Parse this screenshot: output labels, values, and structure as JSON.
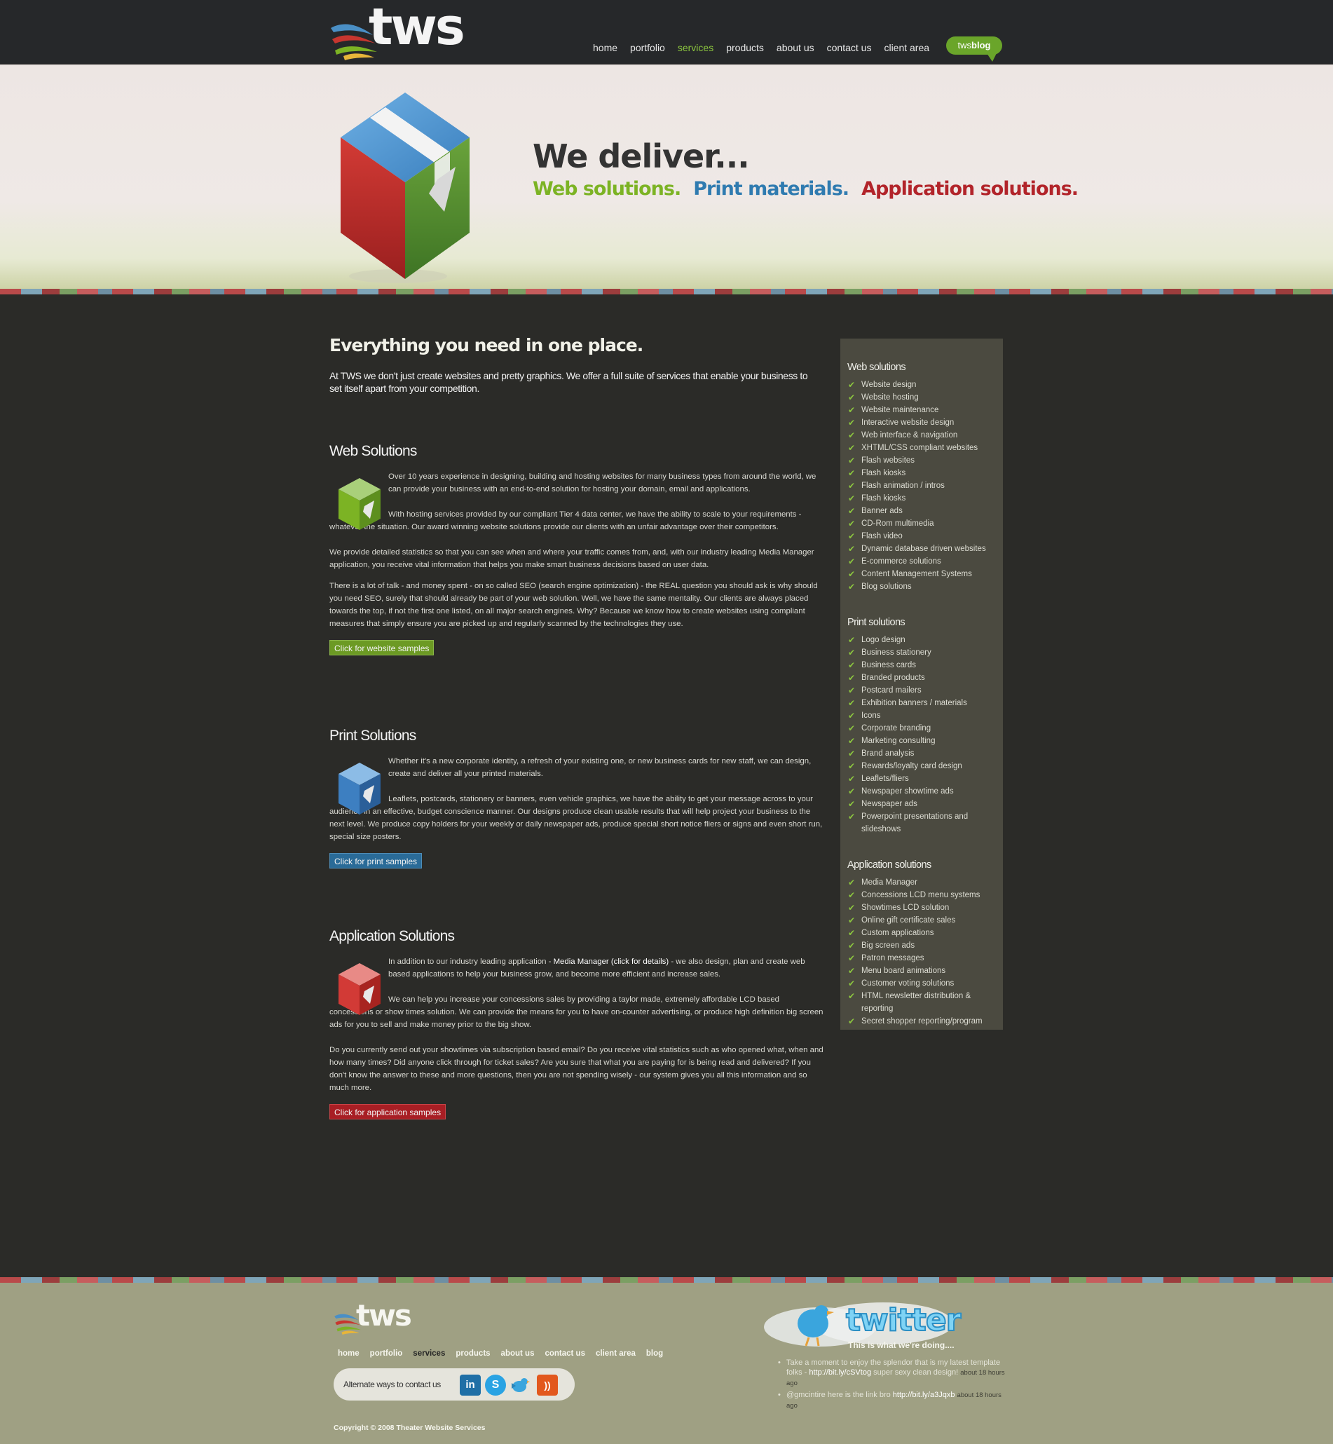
{
  "header": {
    "logo_text": "tws",
    "nav": [
      {
        "label": "home",
        "active": false
      },
      {
        "label": "portfolio",
        "active": false
      },
      {
        "label": "services",
        "active": true
      },
      {
        "label": "products",
        "active": false
      },
      {
        "label": "about us",
        "active": false
      },
      {
        "label": "contact us",
        "active": false
      },
      {
        "label": "client area",
        "active": false
      }
    ],
    "blog_badge": {
      "part1": "tws",
      "part2": "blog"
    }
  },
  "hero": {
    "headline": "We deliver...",
    "subs": [
      "Web solutions.",
      "Print materials.",
      "Application solutions."
    ]
  },
  "main": {
    "title": "Everything you need in one place.",
    "intro": "At TWS we don't just create websites and pretty graphics. We offer a full suite of services that enable your business to set itself apart from your competition.",
    "web": {
      "title": "Web Solutions",
      "p1": "Over 10 years experience in designing, building and hosting websites for many business types from around the world, we can provide your business with an end-to-end solution for hosting your domain, email and applications.",
      "p2": "With hosting services provided by our compliant Tier 4 data center, we have the ability to scale to your requirements - whatever the situation. Our award winning website solutions provide our clients with an unfair advantage over their competitors.",
      "p3": "We provide detailed statistics so that you can see when and where your traffic comes from, and, with our industry leading Media Manager application, you receive vital information that helps you make smart business decisions based on user data.",
      "p4": "There is a lot of talk - and money spent - on so called SEO (search engine optimization) - the REAL question you should ask is why should you need SEO, surely that should already be part of your web solution. Well, we have the same mentality. Our clients are always placed towards the top, if not the first one listed, on all major search engines. Why? Because we know how to create websites using compliant measures that simply ensure you are picked up and regularly scanned by the technologies they use.",
      "button": "Click for website samples"
    },
    "print": {
      "title": "Print Solutions",
      "p1": "Whether it's a new corporate identity, a refresh of your existing one, or new business cards for new staff, we can design, create and deliver all your printed materials.",
      "p2": "Leaflets, postcards, stationery or banners, even vehicle graphics, we have the ability to get your message across to your audience in an effective, budget conscience manner. Our designs produce clean usable results that will help project your business to the next level. We produce copy holders for your weekly or daily newspaper ads, produce special short notice fliers or signs and even short run, special size posters.",
      "button": "Click for print samples"
    },
    "app": {
      "title": "Application Solutions",
      "p1_a": "In addition to our industry leading application - ",
      "p1_link": "Media Manager (click for details)",
      "p1_b": " - we also design, plan and create web based applications to help your business grow, and become more efficient and increase sales.",
      "p2": "We can help you increase your concessions sales by providing a taylor made, extremely affordable LCD based concessions or show times solution. We can provide the means for you to have on-counter advertising, or produce high definition big screen ads for you to sell and make money prior to the big show.",
      "p3": "Do you currently send out your showtimes via subscription based email? Do you receive vital statistics such as who opened what, when and how many times? Did anyone click through for ticket sales? Are you sure that what you are paying for is being read and delivered? If you don't know the answer to these and more questions, then you are not spending wisely - our system gives you all this information and so much more.",
      "button": "Click for application samples"
    }
  },
  "sidebar": {
    "web_title": "Web solutions",
    "web_items": [
      "Website design",
      "Website hosting",
      "Website maintenance",
      "Interactive website design",
      "Web interface & navigation",
      "XHTML/CSS compliant websites",
      "Flash websites",
      "Flash kiosks",
      "Flash animation / intros",
      "Flash kiosks",
      "Banner ads",
      "CD-Rom multimedia",
      "Flash video",
      "Dynamic database driven websites",
      "E-commerce solutions",
      "Content Management Systems",
      "Blog solutions"
    ],
    "print_title": "Print solutions",
    "print_items": [
      "Logo design",
      "Business stationery",
      "Business cards",
      "Branded products",
      "Postcard mailers",
      "Exhibition banners / materials",
      "Icons",
      "Corporate branding",
      "Marketing consulting",
      "Brand analysis",
      "Rewards/loyalty card design",
      "Leaflets/fliers",
      "Newspaper showtime ads",
      "Newspaper ads",
      "Powerpoint presentations and slideshows"
    ],
    "app_title": "Application solutions",
    "app_items": [
      "Media Manager",
      "Concessions LCD menu systems",
      "Showtimes LCD solution",
      "Online gift certificate sales",
      "Custom applications",
      "Big screen ads",
      "Patron messages",
      "Menu board animations",
      "Customer voting solutions",
      "HTML newsletter distribution & reporting",
      "Secret shopper reporting/program"
    ]
  },
  "footer": {
    "logo_text": "tws",
    "nav": [
      {
        "label": "home",
        "active": false
      },
      {
        "label": "portfolio",
        "active": false
      },
      {
        "label": "services",
        "active": true
      },
      {
        "label": "products",
        "active": false
      },
      {
        "label": "about us",
        "active": false
      },
      {
        "label": "contact us",
        "active": false
      },
      {
        "label": "client area",
        "active": false
      },
      {
        "label": "blog",
        "active": false
      }
    ],
    "contact_label": "Alternate ways to contact us",
    "social": [
      "linkedin-icon",
      "skype-icon",
      "twitter-bird-icon",
      "rss-icon"
    ],
    "copyright": "Copyright © 2008 Theater Website Services",
    "twitter_title": "twitter",
    "twitter_sub": "This is what we're doing....",
    "tweets": [
      {
        "text": "Take a moment to enjoy the splendor that is my latest template folks - ",
        "link": "http://bit.ly/cSVtog",
        "after": " super sexy clean design!",
        "ago": "about 18 hours ago"
      },
      {
        "text": "@gmcintire here is the link bro ",
        "link": "http://bit.ly/a3Jqxb",
        "after": "",
        "ago": "about 18 hours ago"
      }
    ]
  },
  "colors": {
    "accent_green": "#7cb324",
    "accent_blue": "#2f7bb0",
    "accent_red": "#b2242a",
    "header_bg": "#26282a",
    "body_bg": "#2b2b28",
    "sidebar_bg": "#4b4a40",
    "footer_bg": "#9fa083"
  }
}
